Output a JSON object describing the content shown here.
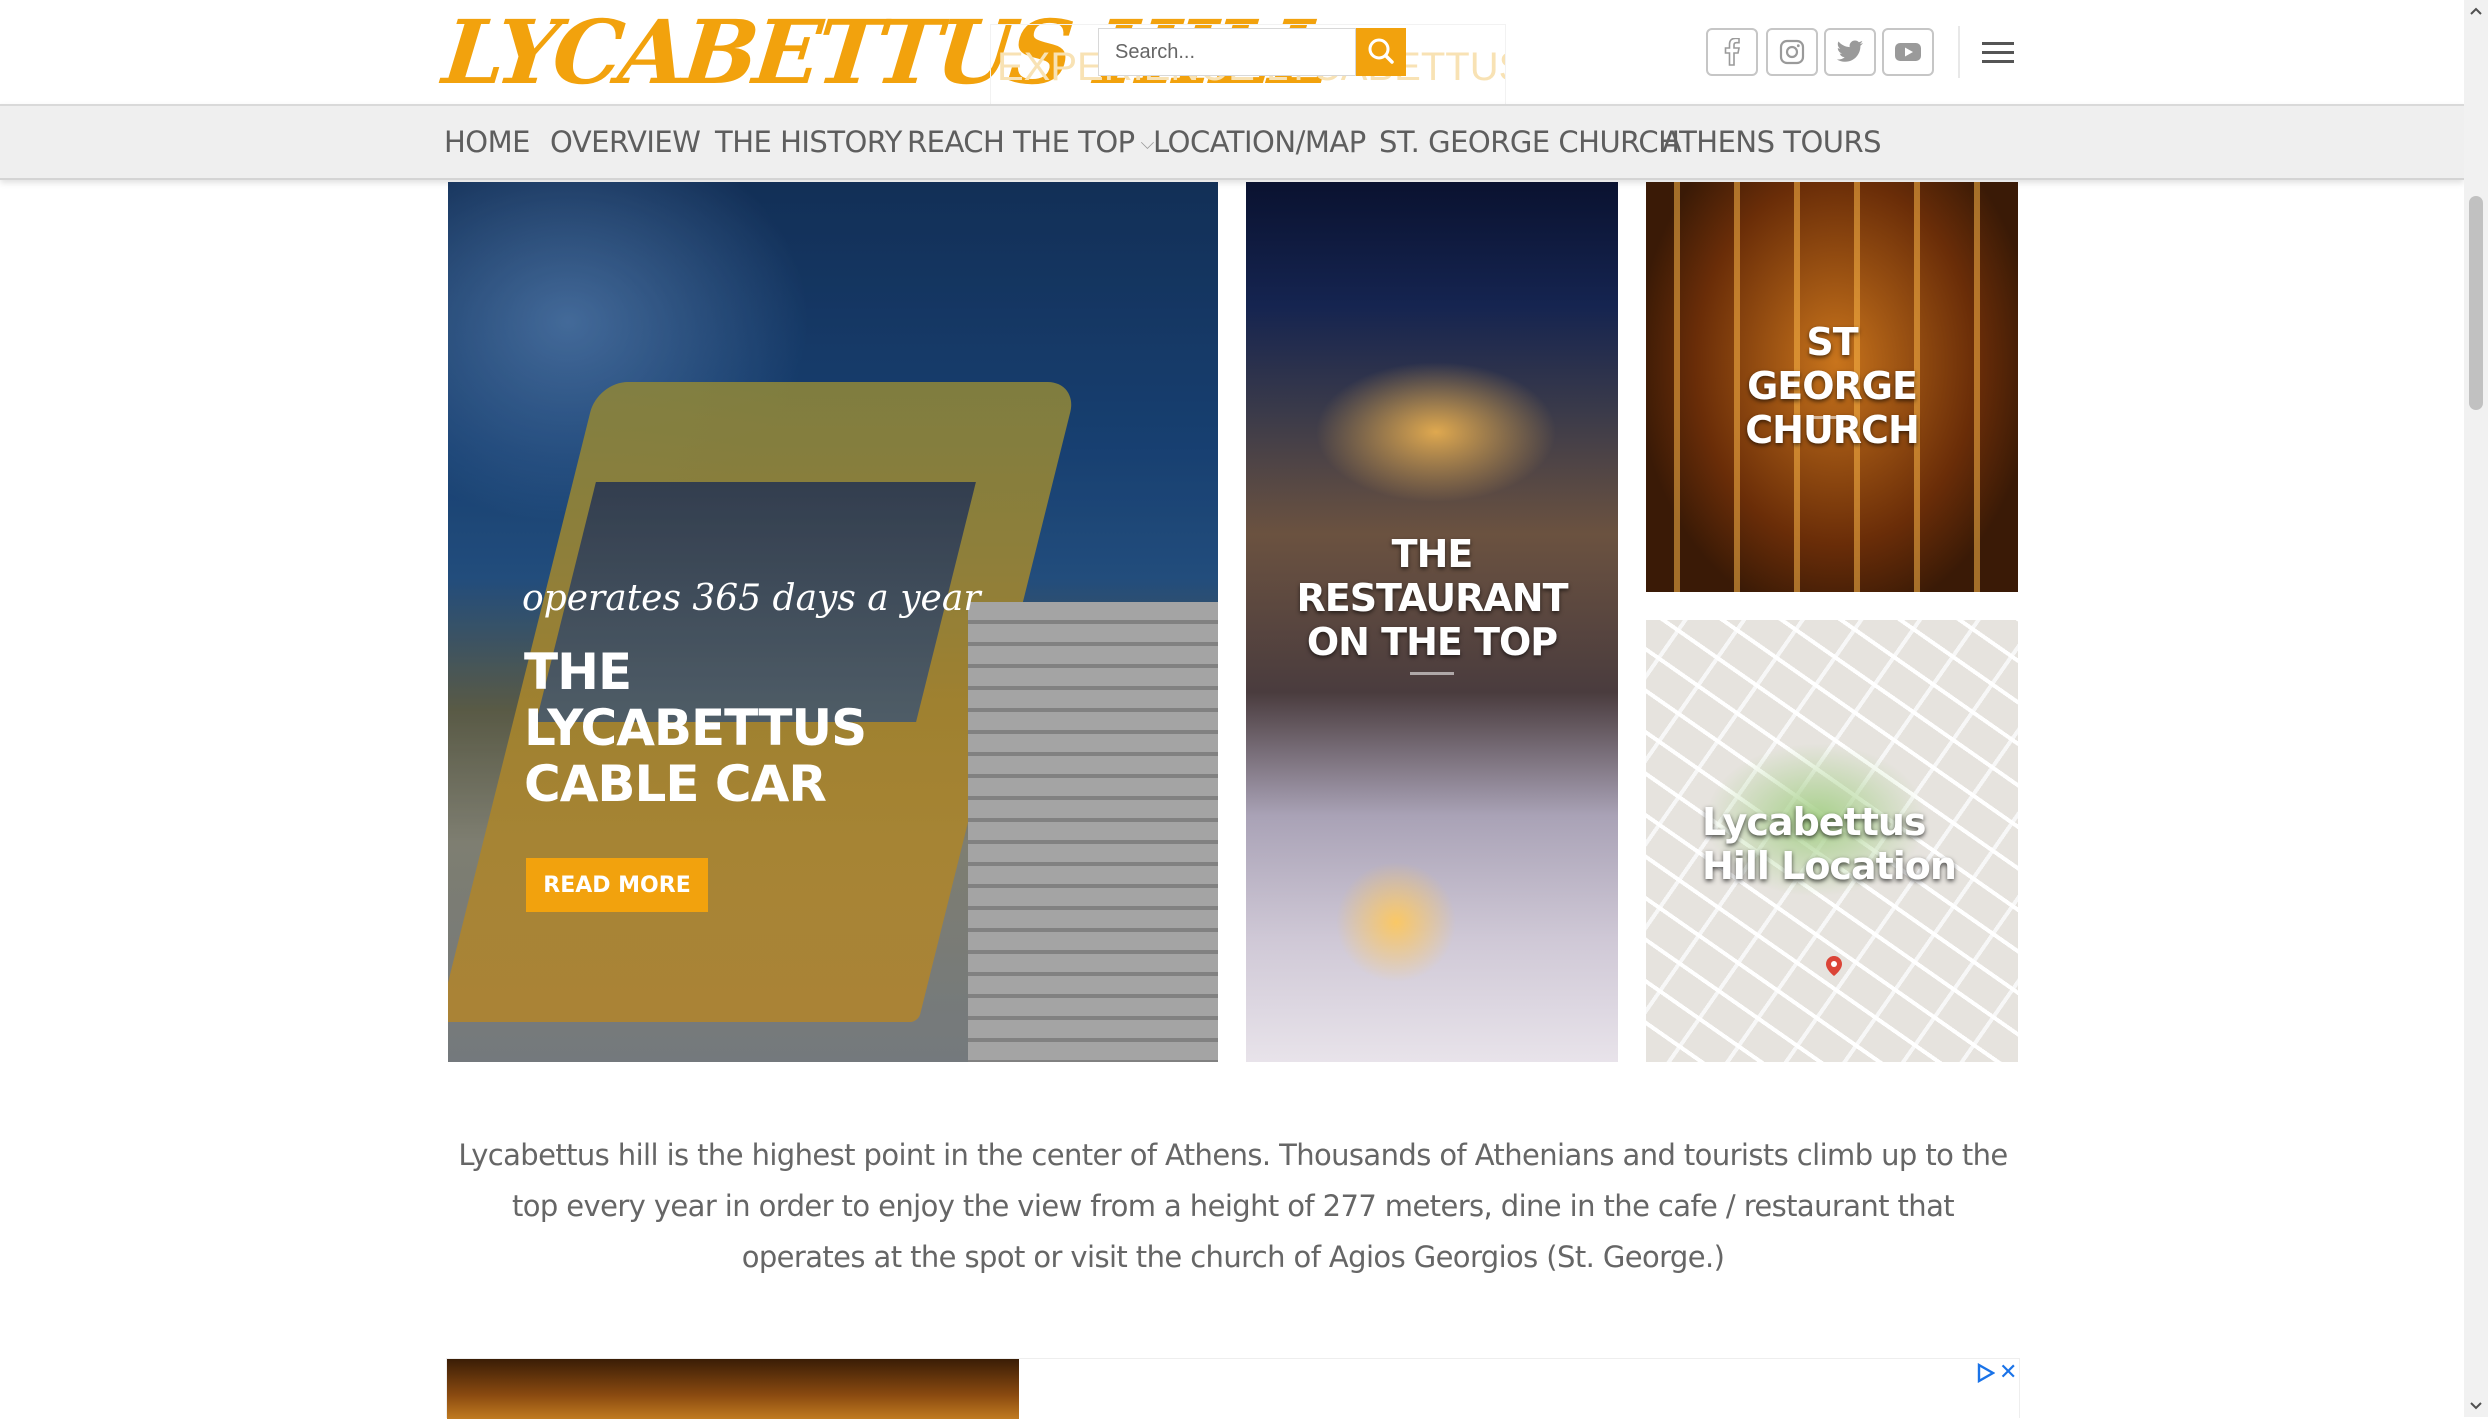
{
  "header": {
    "logo_text": "LYCABETTUS HILL",
    "ghost_title": "EXPERIENCE LYCABETTUS HILL",
    "search": {
      "placeholder": "Search..."
    },
    "social_icons": [
      "facebook-icon",
      "instagram-icon",
      "twitter-icon",
      "youtube-icon"
    ],
    "brand_color": "#f2a20d"
  },
  "nav": {
    "items": [
      {
        "label": "HOME"
      },
      {
        "label": "OVERVIEW"
      },
      {
        "label": "THE HISTORY"
      },
      {
        "label": "REACH THE TOP",
        "has_dropdown": true
      },
      {
        "label": "LOCATION/MAP"
      },
      {
        "label": "ST. GEORGE CHURCH"
      },
      {
        "label": "ATHENS TOURS"
      }
    ]
  },
  "tiles": {
    "cable_car": {
      "subtitle": "operates 365 days a year",
      "title": "THE LYCABETTUS CABLE CAR",
      "button": "READ MORE"
    },
    "restaurant": {
      "title": "THE RESTAURANT ON THE TOP"
    },
    "church": {
      "title": "ST GEORGE CHURCH"
    },
    "map": {
      "title": "Lycabettus Hill Location"
    }
  },
  "intro": {
    "text": "Lycabettus hill is the highest point in the center of Athens. Thousands of Athenians and tourists climb up to the top every year in order to enjoy the view from a height of 277 meters, dine in the cafe / restaurant that operates at the spot or visit the church of Agios Georgios (St. George.)"
  },
  "ad": {
    "close_label": "✕"
  }
}
